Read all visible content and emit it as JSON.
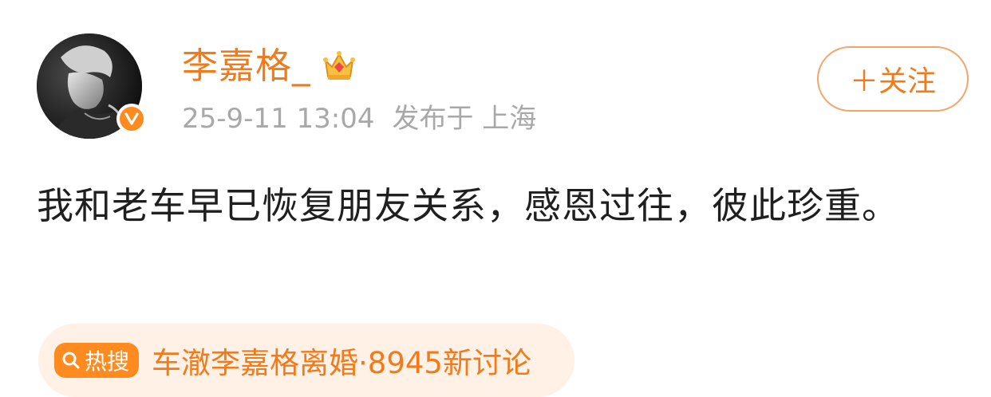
{
  "user": {
    "name": "李嘉格_",
    "timestamp": "25-9-11 13:04",
    "location": "发布于 上海"
  },
  "follow_button": {
    "label": "＋关注"
  },
  "post": {
    "text": "我和老车早已恢复朋友关系，感恩过往，彼此珍重。"
  },
  "hot_search": {
    "badge": "热搜",
    "topic": "车澈李嘉格离婚·8945新讨论"
  },
  "colors": {
    "accent": "#f27a1a",
    "badge": "#ff8a1f",
    "pill_bg": "#fff1e6",
    "meta": "#a8a8a8"
  },
  "icons": {
    "avatar": "user-avatar",
    "verified": "verified-v-icon",
    "crown": "crown-icon",
    "hot": "search-icon"
  }
}
